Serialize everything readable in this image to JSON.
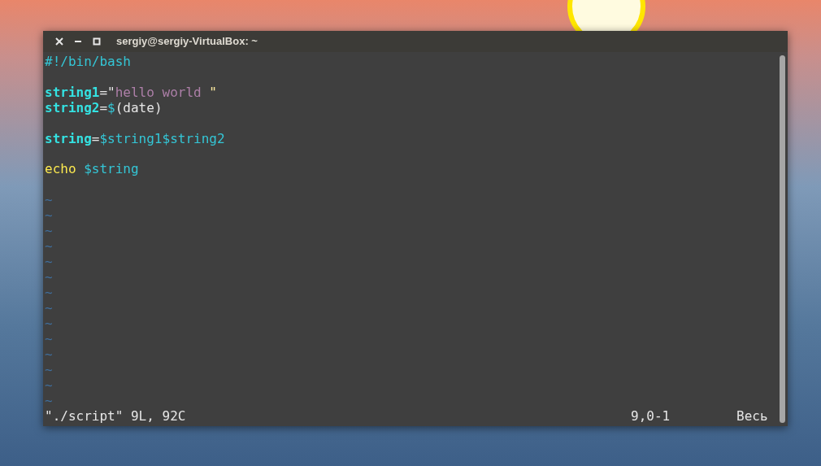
{
  "window": {
    "title": "sergiy@sergiy-VirtualBox: ~"
  },
  "editor": {
    "lines": [
      {
        "kind": "code",
        "tokens": [
          {
            "kind": "comment",
            "text": "#!/bin/bash"
          }
        ]
      },
      {
        "kind": "blank"
      },
      {
        "kind": "code",
        "tokens": [
          {
            "kind": "identifier",
            "text": "string1"
          },
          {
            "kind": "operator",
            "text": "=\""
          },
          {
            "kind": "string",
            "text": "hello world "
          },
          {
            "kind": "quote",
            "text": "\""
          }
        ]
      },
      {
        "kind": "code",
        "tokens": [
          {
            "kind": "identifier",
            "text": "string2"
          },
          {
            "kind": "operator",
            "text": "="
          },
          {
            "kind": "expansion",
            "text": "$"
          },
          {
            "kind": "operator",
            "text": "(date)"
          }
        ]
      },
      {
        "kind": "blank"
      },
      {
        "kind": "code",
        "tokens": [
          {
            "kind": "identifier",
            "text": "string"
          },
          {
            "kind": "operator",
            "text": "="
          },
          {
            "kind": "expansion",
            "text": "$string1$string2"
          }
        ]
      },
      {
        "kind": "blank"
      },
      {
        "kind": "code",
        "tokens": [
          {
            "kind": "keyword",
            "text": "echo"
          },
          {
            "kind": "expansion",
            "text": "$string",
            "gap_before": true
          }
        ]
      },
      {
        "kind": "blank"
      }
    ],
    "empty_line_markers": [
      "~",
      "~",
      "~",
      "~",
      "~",
      "~",
      "~",
      "~",
      "~",
      "~",
      "~",
      "~",
      "~",
      "~"
    ]
  },
  "status_bar": {
    "file_info": "\"./script\" 9L, 92C",
    "cursor_position": "9,0-1",
    "scroll_position": "Весь"
  }
}
